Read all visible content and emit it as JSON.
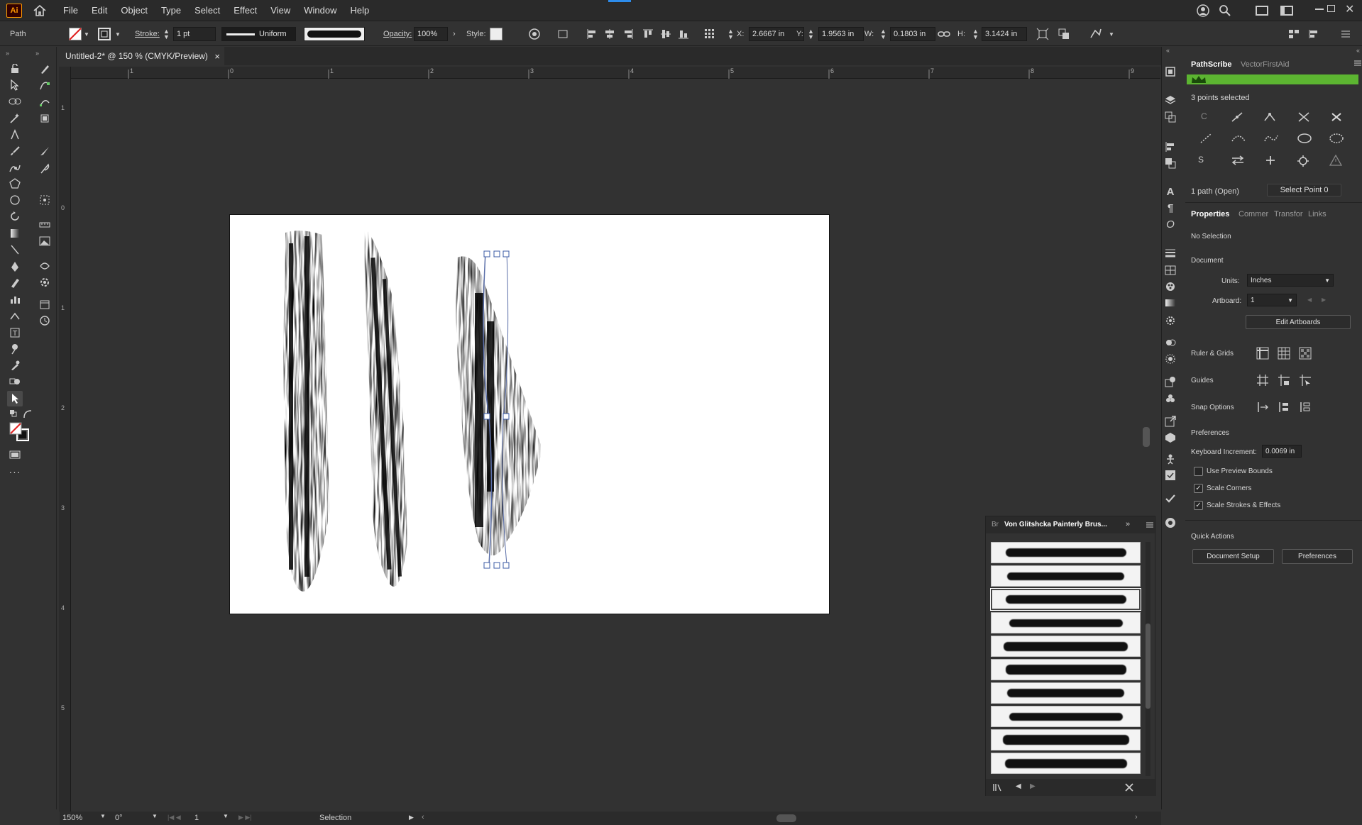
{
  "app": {
    "logo": "Ai"
  },
  "menu": [
    "File",
    "Edit",
    "Object",
    "Type",
    "Select",
    "Effect",
    "View",
    "Window",
    "Help"
  ],
  "control_bar": {
    "selection_type": "Path",
    "stroke_label": "Stroke:",
    "stroke_value": "1 pt",
    "stroke_profile": "Uniform",
    "opacity_label": "Opacity:",
    "opacity_value": "100%",
    "style_label": "Style:",
    "x_label": "X:",
    "x_value": "2.6667 in",
    "y_label": "Y:",
    "y_value": "1.9563 in",
    "w_label": "W:",
    "w_value": "0.1803 in",
    "h_label": "H:",
    "h_value": "3.1424 in"
  },
  "document_tab": {
    "title": "Untitled-2* @ 150 % (CMYK/Preview)",
    "close": "×"
  },
  "ruler_h_labels": [
    "1",
    "0",
    "1",
    "2",
    "3",
    "4",
    "5",
    "6",
    "7",
    "8",
    "9"
  ],
  "ruler_v_labels": [
    "1",
    "0",
    "1",
    "2",
    "3",
    "4",
    "5"
  ],
  "pathscribe": {
    "tabs": [
      "PathScribe",
      "VectorFirstAid"
    ],
    "status": "3 points selected",
    "c_label": "C",
    "s_label": "S",
    "path_info": "1 path (Open)",
    "select_point": "Select Point 0"
  },
  "properties": {
    "tabs": [
      "Properties",
      "Commer",
      "Transfor",
      "Links"
    ],
    "no_selection": "No Selection",
    "document_heading": "Document",
    "units_label": "Units:",
    "units_value": "Inches",
    "artboard_label": "Artboard:",
    "artboard_value": "1",
    "edit_artboards": "Edit Artboards",
    "ruler_grids": "Ruler & Grids",
    "guides": "Guides",
    "snap_options": "Snap Options",
    "preferences_heading": "Preferences",
    "keyboard_increment_label": "Keyboard Increment:",
    "keyboard_increment_value": "0.0069 in",
    "checks": [
      {
        "label": "Use Preview Bounds",
        "checked": false
      },
      {
        "label": "Scale Corners",
        "checked": true
      },
      {
        "label": "Scale Strokes & Effects",
        "checked": true
      }
    ],
    "quick_actions": "Quick Actions",
    "document_setup": "Document Setup",
    "preferences_button": "Preferences"
  },
  "brush_panel": {
    "short_tab": "Br",
    "title": "Von Glitshcka Painterly Brus...",
    "count": 10,
    "selected_index": 2
  },
  "status_bar": {
    "zoom": "150%",
    "rotation": "0°",
    "artboard": "1",
    "tool": "Selection"
  },
  "colors": {
    "ui_bg": "#323232",
    "accent_green": "#5cb531",
    "artboard": "#ffffff",
    "ai_orange": "#ff9a00"
  }
}
